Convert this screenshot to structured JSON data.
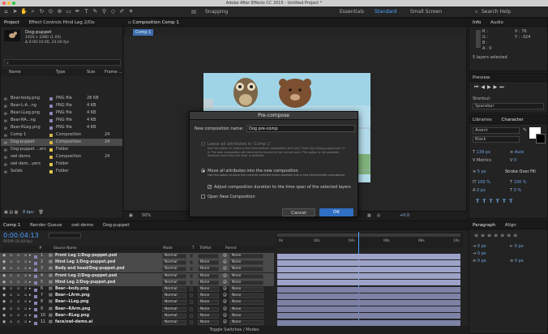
{
  "app": {
    "title": "Adobe After Effects CC 2015 - Untitled Project *"
  },
  "toolbar": {
    "snapping": "Snapping",
    "workspaces": [
      "Essentials",
      "Standard",
      "Small Screen"
    ],
    "active_workspace": "Standard",
    "search_label": "Search Help",
    "search_icon": "magnifier"
  },
  "project": {
    "tabs": [
      "Project",
      "Effect Controls Hind Leg 2/Do"
    ],
    "selected_name": "Dog-puppet",
    "selected_info": "1920 x 1080 (1.00)",
    "selected_duration": "Δ 0:00:10:00, 24.00 fps",
    "search_placeholder": "",
    "columns": [
      "Name",
      "Type",
      "Size",
      "Frame ..."
    ],
    "items": [
      {
        "name": "Bear-body.png",
        "type": "PNG file",
        "size": "28 KB",
        "fr": "",
        "color": "#8c83b4"
      },
      {
        "name": "Bear-L-A...ng",
        "type": "PNG file",
        "size": "4 KB",
        "fr": "",
        "color": "#8c83b4"
      },
      {
        "name": "Bear-LLeg.png",
        "type": "PNG file",
        "size": "4 KB",
        "fr": "",
        "color": "#8c83b4"
      },
      {
        "name": "Bear-RA...ng",
        "type": "PNG file",
        "size": "4 KB",
        "fr": "",
        "color": "#8c83b4"
      },
      {
        "name": "Bear-RLeg.png",
        "type": "PNG file",
        "size": "4 KB",
        "fr": "",
        "color": "#8c83b4"
      },
      {
        "name": "Comp 1",
        "type": "Composition",
        "size": "",
        "fr": "24",
        "color": "#d1b24a"
      },
      {
        "name": "Dog-puppet",
        "type": "Composition",
        "size": "",
        "fr": "24",
        "color": "#d1b24a",
        "selected": true
      },
      {
        "name": "Dog-puppet ...ers",
        "type": "Folder",
        "size": "",
        "fr": "",
        "color": "#e0c84a"
      },
      {
        "name": "owl-demo",
        "type": "Composition",
        "size": "",
        "fr": "24",
        "color": "#d1b24a"
      },
      {
        "name": "owl-dem...yers",
        "type": "Folder",
        "size": "",
        "fr": "",
        "color": "#e0c84a"
      },
      {
        "name": "Solids",
        "type": "Folder",
        "size": "",
        "fr": "",
        "color": "#e0c84a"
      }
    ],
    "bpc": "8 bpc"
  },
  "composition": {
    "tab": "Composition Comp 1",
    "subtab": "Comp 1",
    "zoom": "50%",
    "exposure": "+0.0"
  },
  "dialog": {
    "title": "Pre-compose",
    "name_label": "New composition name:",
    "name_value": "Dog pre-comp",
    "opt1_label": "Leave all attributes in 'Comp 1'",
    "opt1_desc": "Use this option to create a new intermediate composition with only 'Front Leg 1/Dog-puppet.psd'. in it. The new composition will become the source to the current layer. This option is not available because more than one layer is selected.",
    "opt2_label": "Move all attributes into the new composition",
    "opt2_desc": "Use this option to place the currently selected layers together into a new intermediate composition.",
    "adjust_label": "Adjust composition duration to the time span of the selected layers",
    "open_label": "Open New Composition",
    "cancel": "Cancel",
    "ok": "OK"
  },
  "info": {
    "tabs": [
      "Info",
      "Audio"
    ],
    "r": "R :",
    "g": "G :",
    "b": "B :",
    "a": "A : 0",
    "x": "X : 76",
    "y": "Y : -324",
    "status": "5 layers selected"
  },
  "preview": {
    "title": "Preview",
    "shortcut_label": "Shortcut",
    "shortcut_value": "Spacebar"
  },
  "character": {
    "tabs": [
      "Libraries",
      "Character"
    ],
    "font": "Avenir",
    "style": "Black",
    "size": "139 px",
    "leading": "Auto",
    "kerning": "Metrics",
    "tracking": "0",
    "stroke": "5 px",
    "stroke_type": "Stroke Over Fill",
    "vscale": "100 %",
    "hscale": "100 %",
    "baseline": "0 px",
    "tsume": "0 %"
  },
  "paragraph": {
    "tabs": [
      "Paragraph",
      "Align"
    ],
    "v1": "0 px",
    "v2": "0 px",
    "v3": "0 px",
    "v4": "0 px",
    "v5": "0 px"
  },
  "timeline": {
    "tabs": [
      "Comp 1",
      "Render Queue",
      "owl-demo",
      "Dog-puppet"
    ],
    "timecode": "0:00:04:13",
    "timecode_sub": "00109 (24.00 fps)",
    "columns": [
      "#",
      "Source Name",
      "Mode",
      "T",
      "TrkMat",
      "Parent"
    ],
    "ruler": [
      "0s",
      "02s",
      "04s",
      "06s",
      "08s",
      "10s"
    ],
    "layers": [
      {
        "num": "1",
        "name": "Front Leg 1/Dog-puppet.psd",
        "mode": "Normal",
        "trk": "",
        "parent": "None",
        "sel": true,
        "color": "#8c83b4"
      },
      {
        "num": "2",
        "name": "Hind Leg 1/Dog-puppet.psd",
        "mode": "Normal",
        "trk": "None",
        "parent": "None",
        "sel": true,
        "color": "#8c83b4"
      },
      {
        "num": "3",
        "name": "Body and head/Dog-puppet.psd",
        "mode": "Normal",
        "trk": "None",
        "parent": "None",
        "sel": true,
        "color": "#8c83b4"
      },
      {
        "num": "4",
        "name": "Front Leg 2/Dog-puppet.psd",
        "mode": "Normal",
        "trk": "None",
        "parent": "None",
        "sel": true,
        "color": "#8c83b4"
      },
      {
        "num": "5",
        "name": "Hind Leg 2/Dog-puppet.psd",
        "mode": "Normal",
        "trk": "None",
        "parent": "None",
        "sel": true,
        "color": "#8c83b4"
      },
      {
        "num": "6",
        "name": "Bear--body.png",
        "mode": "Normal",
        "trk": "None",
        "parent": "None",
        "sel": false,
        "color": "#8c83b4"
      },
      {
        "num": "7",
        "name": "Bear--LArm.png",
        "mode": "Normal",
        "trk": "None",
        "parent": "None",
        "sel": false,
        "color": "#8c83b4"
      },
      {
        "num": "8",
        "name": "Bear--LLeg.png",
        "mode": "Normal",
        "trk": "None",
        "parent": "None",
        "sel": false,
        "color": "#8c83b4"
      },
      {
        "num": "9",
        "name": "Bear--RArm.png",
        "mode": "Normal",
        "trk": "None",
        "parent": "None",
        "sel": false,
        "color": "#8c83b4"
      },
      {
        "num": "10",
        "name": "Bear--RLeg.png",
        "mode": "Normal",
        "trk": "None",
        "parent": "None",
        "sel": false,
        "color": "#8c83b4"
      },
      {
        "num": "11",
        "name": "face/owl-demo.ai",
        "mode": "Normal",
        "trk": "None",
        "parent": "None",
        "sel": false,
        "color": "#8c83b4"
      }
    ],
    "footer": "Toggle Switches / Modes"
  }
}
